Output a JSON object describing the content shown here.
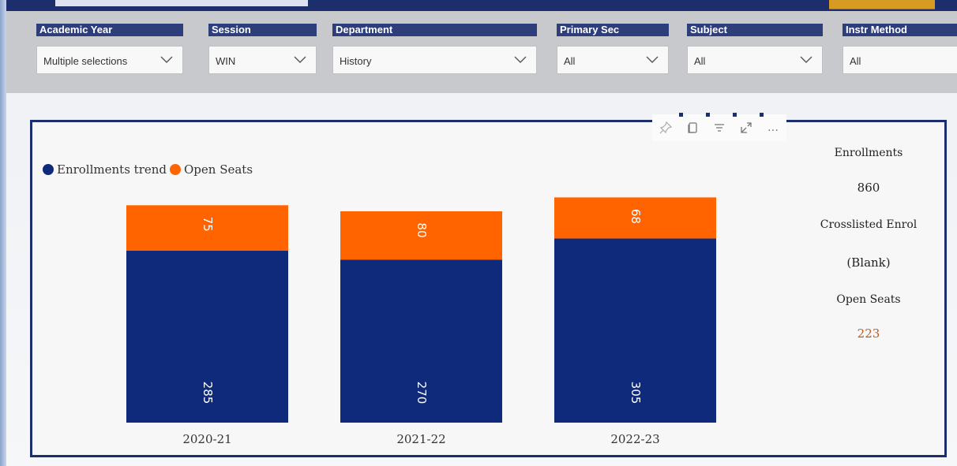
{
  "filters": [
    {
      "label": "Academic Year",
      "value": "Multiple selections"
    },
    {
      "label": "Session",
      "value": "WIN"
    },
    {
      "label": "Department",
      "value": "History"
    },
    {
      "label": "Primary Sec",
      "value": "All"
    },
    {
      "label": "Subject",
      "value": "All"
    },
    {
      "label": "Instr Method",
      "value": "All"
    }
  ],
  "toolbar": {
    "icons": [
      "pin-icon",
      "copy-icon",
      "filter-icon",
      "focus-mode-icon",
      "more-options-icon"
    ],
    "more_glyph": "…"
  },
  "colors": {
    "enrollments": "#0f2a7b",
    "open_seats": "#ff6400",
    "frame": "#1c2e6b",
    "open_seats_value": "#c05a1a"
  },
  "chart_data": {
    "type": "bar",
    "stacked": true,
    "categories": [
      "2020-21",
      "2021-22",
      "2022-23"
    ],
    "series": [
      {
        "name": "Enrollments trend",
        "values": [
          285,
          270,
          305
        ]
      },
      {
        "name": "Open Seats",
        "values": [
          75,
          80,
          68
        ]
      }
    ],
    "legend_position": "top-left",
    "ylim": [
      0,
      380
    ],
    "grid": false
  },
  "stats_card": {
    "enrollments_label": "Enrollments",
    "enrollments_value": "860",
    "crosslisted_label": "Crosslisted Enrol",
    "crosslisted_value": "(Blank)",
    "open_seats_label": "Open Seats",
    "open_seats_value": "223"
  }
}
